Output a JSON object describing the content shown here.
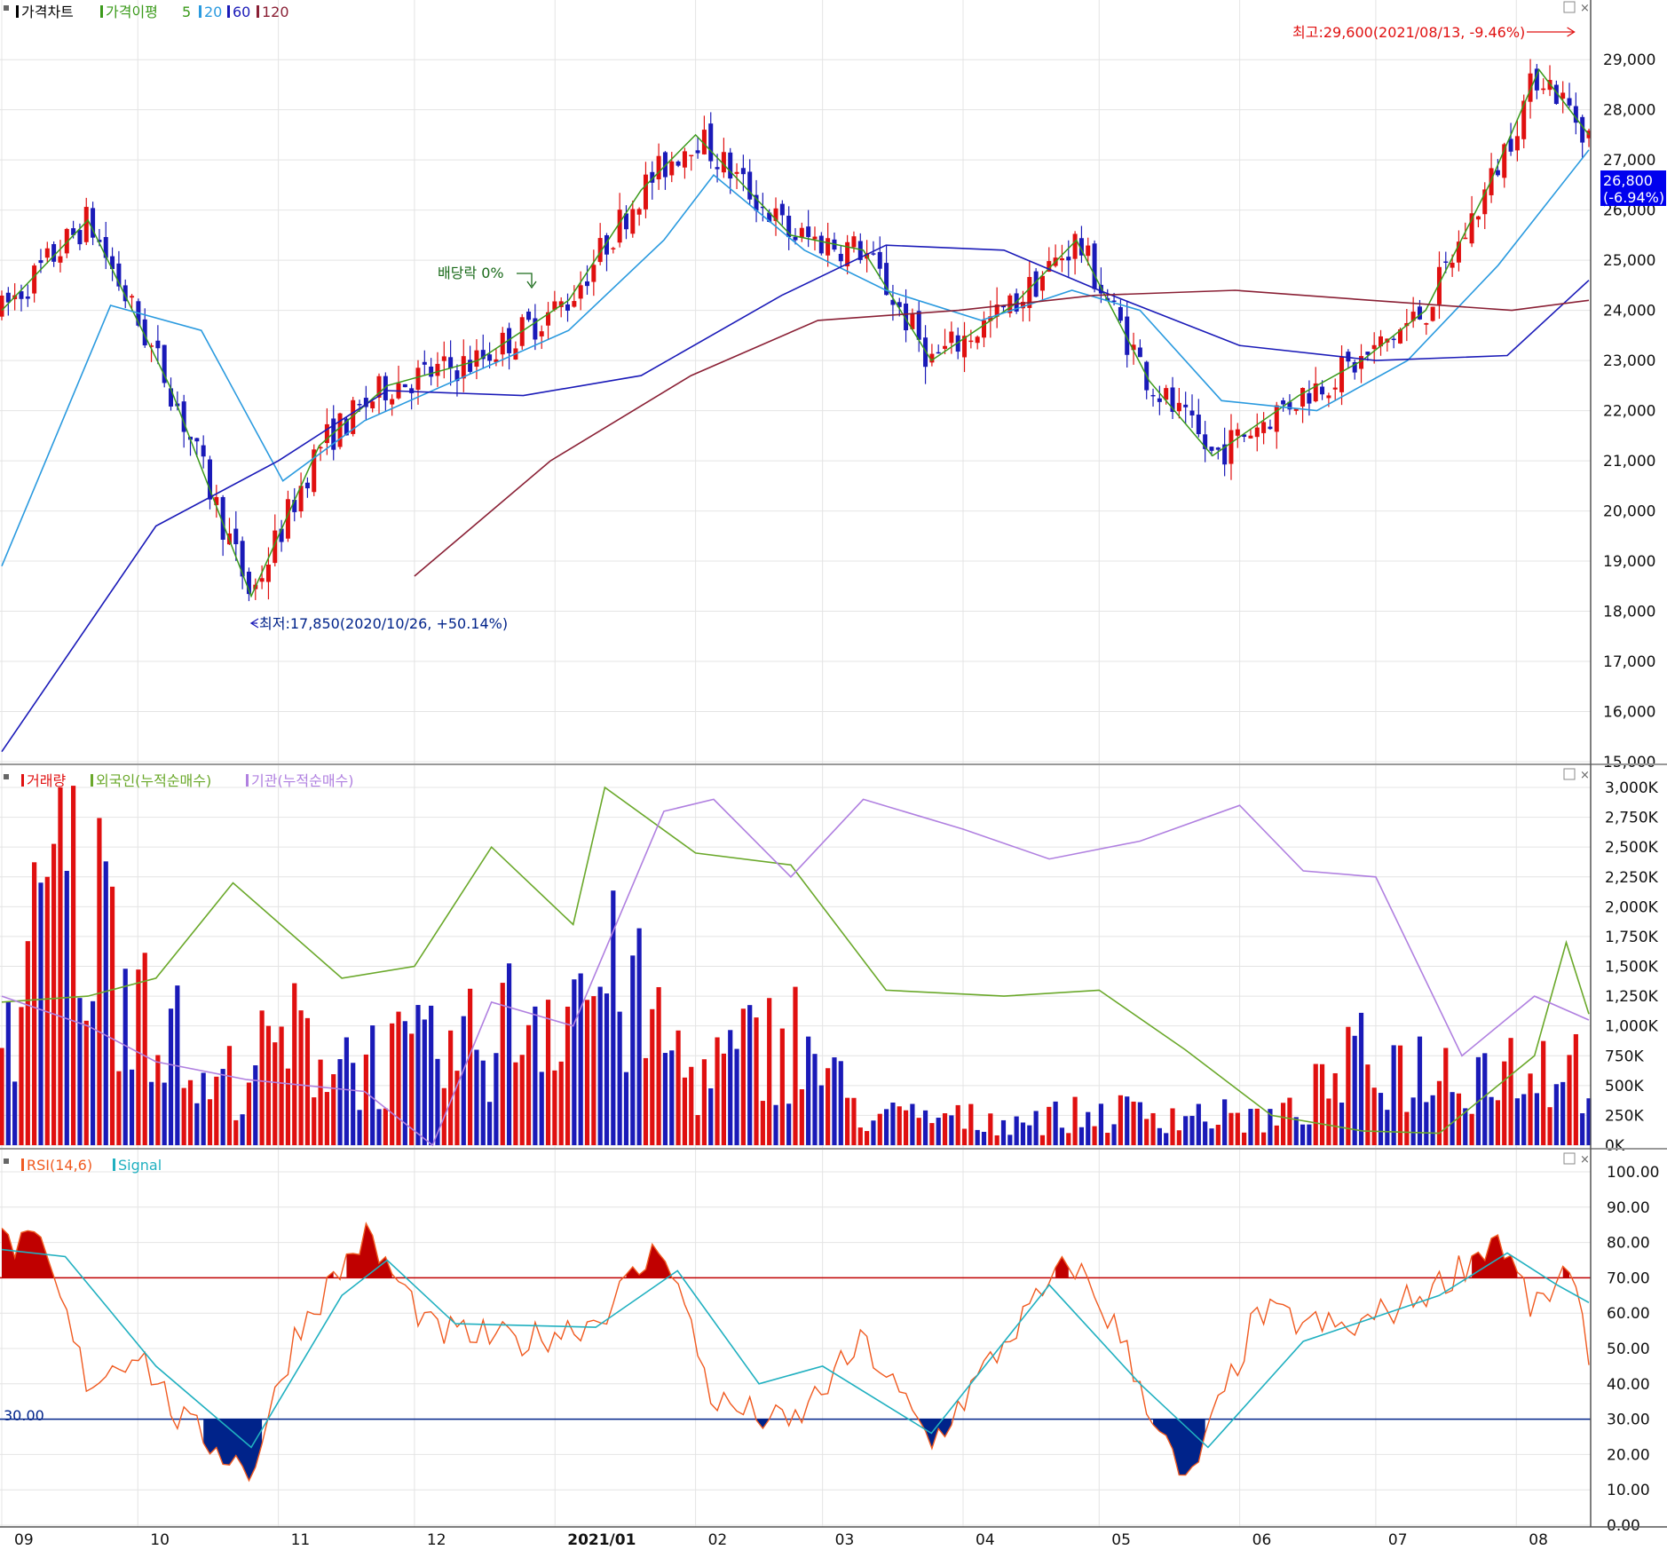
{
  "window_title": "가격차트",
  "colors": {
    "up": "#e01010",
    "down": "#1a1ab8",
    "ma5": "#3a9a1a",
    "ma20": "#2a9adf",
    "ma60": "#1a1ab8",
    "ma120": "#8a2035",
    "grid": "#e4e4e4",
    "foreign": "#6aa82a",
    "institution": "#b080e0",
    "rsi": "#f05a20",
    "signal": "#20b0c0",
    "overbought": "#c00000",
    "oversold": "#00238a",
    "current_price_bg": "#0000ee"
  },
  "icons": [
    "restore-icon",
    "close-icon",
    "series-marker-icon"
  ],
  "price_panel": {
    "legend": {
      "title": "가격차트",
      "ma_label": "가격이평",
      "ma_periods": [
        "5",
        "20",
        "60",
        "120"
      ]
    },
    "y_ticks": [
      "29,000",
      "28,000",
      "27,000",
      "26,000",
      "25,000",
      "24,000",
      "23,000",
      "22,000",
      "21,000",
      "20,000",
      "19,000",
      "18,000",
      "17,000",
      "16,000",
      "15,000"
    ],
    "high_annotation": "최고:29,600(2021/08/13, -9.46%)",
    "low_annotation": "최저:17,850(2020/10/26, +50.14%)",
    "dividend_annotation": "배당락 0%",
    "current_price": "26,800",
    "current_change": "(-6.94%)"
  },
  "volume_panel": {
    "legend": {
      "volume": "거래량",
      "foreign": "외국인(누적순매수)",
      "institution": "기관(누적순매수)"
    },
    "y_ticks": [
      "3,000K",
      "2,750K",
      "2,500K",
      "2,250K",
      "2,000K",
      "1,750K",
      "1,500K",
      "1,250K",
      "1,000K",
      "750K",
      "500K",
      "250K",
      "0K"
    ]
  },
  "rsi_panel": {
    "legend": {
      "rsi": "RSI(14,6)",
      "signal": "Signal"
    },
    "y_ticks": [
      "100.00",
      "90.00",
      "80.00",
      "70.00",
      "60.00",
      "50.00",
      "40.00",
      "30.00",
      "20.00",
      "10.00",
      "0.00"
    ],
    "level_label": "30.00"
  },
  "x_axis": [
    "09",
    "10",
    "11",
    "12",
    "2021/01",
    "02",
    "03",
    "04",
    "05",
    "06",
    "07",
    "08"
  ],
  "chart_data": [
    {
      "type": "candlestick",
      "title": "가격차트",
      "ylim": [
        15000,
        29800
      ],
      "series": [
        {
          "name": "5",
          "x": [
            "2020-09-01",
            "2020-09-20",
            "2020-10-08",
            "2020-10-26",
            "2020-11-10",
            "2020-11-25",
            "2020-12-15",
            "2021-01-04",
            "2021-01-20",
            "2021-02-01",
            "2021-02-22",
            "2021-03-10",
            "2021-03-25",
            "2021-04-12",
            "2021-04-26",
            "2021-05-12",
            "2021-05-26",
            "2021-06-14",
            "2021-06-28",
            "2021-07-12",
            "2021-07-26",
            "2021-08-06",
            "2021-08-17"
          ],
          "values": [
            24000,
            25800,
            22500,
            18300,
            21300,
            22500,
            23000,
            24200,
            26400,
            27500,
            25500,
            25200,
            23000,
            24100,
            25400,
            22600,
            21100,
            22300,
            23000,
            24000,
            26500,
            28800,
            27500
          ]
        },
        {
          "name": "20",
          "x": [
            "2020-09-01",
            "2020-09-25",
            "2020-10-15",
            "2020-11-02",
            "2020-11-20",
            "2020-12-10",
            "2021-01-04",
            "2021-01-25",
            "2021-02-05",
            "2021-02-25",
            "2021-03-15",
            "2021-04-05",
            "2021-04-25",
            "2021-05-10",
            "2021-05-28",
            "2021-06-18",
            "2021-07-08",
            "2021-07-28",
            "2021-08-17"
          ],
          "values": [
            18900,
            24100,
            23600,
            20600,
            21800,
            22600,
            23600,
            25400,
            26700,
            25200,
            24400,
            23800,
            24400,
            24000,
            22200,
            22000,
            23000,
            24900,
            27200
          ]
        },
        {
          "name": "60",
          "x": [
            "2020-09-01",
            "2020-10-05",
            "2020-11-01",
            "2020-11-25",
            "2020-12-25",
            "2021-01-20",
            "2021-02-20",
            "2021-03-15",
            "2021-04-10",
            "2021-05-01",
            "2021-06-01",
            "2021-07-01",
            "2021-07-30",
            "2021-08-17"
          ],
          "values": [
            15200,
            19700,
            21000,
            22400,
            22300,
            22700,
            24300,
            25300,
            25200,
            24400,
            23300,
            23000,
            23100,
            24600
          ]
        },
        {
          "name": "120",
          "x": [
            "2020-12-01",
            "2020-12-31",
            "2021-01-31",
            "2021-02-28",
            "2021-03-31",
            "2021-04-30",
            "2021-05-31",
            "2021-06-30",
            "2021-07-31",
            "2021-08-17"
          ],
          "values": [
            18700,
            21000,
            22700,
            23800,
            24000,
            24300,
            24400,
            24200,
            24000,
            24200
          ]
        }
      ],
      "annotations": [
        {
          "text": "최고:29,600(2021/08/13, -9.46%)",
          "x": "2021-08-13",
          "y": 29600
        },
        {
          "text": "최저:17,850(2020/10/26, +50.14%)",
          "x": "2020-10-26",
          "y": 17850
        },
        {
          "text": "배당락 0%",
          "x": "2020-12-28",
          "y": 24600
        }
      ],
      "last": {
        "x": "2021-08-17",
        "y": 26800,
        "change": "-6.94%"
      }
    },
    {
      "type": "bar",
      "title": "거래량",
      "ylim": [
        0,
        3000
      ],
      "units": "K",
      "series": [
        {
          "name": "외국인(누적순매수)",
          "type": "line",
          "x": [
            "2020-09-01",
            "2020-09-20",
            "2020-10-05",
            "2020-10-22",
            "2020-11-15",
            "2020-12-01",
            "2020-12-18",
            "2021-01-05",
            "2021-01-12",
            "2021-02-01",
            "2021-02-22",
            "2021-03-15",
            "2021-04-10",
            "2021-05-01",
            "2021-05-20",
            "2021-06-08",
            "2021-06-28",
            "2021-07-15",
            "2021-08-05",
            "2021-08-12",
            "2021-08-17"
          ],
          "values": [
            1200,
            1250,
            1400,
            2200,
            1400,
            1500,
            2500,
            1850,
            3000,
            2450,
            2350,
            1300,
            1250,
            1300,
            800,
            250,
            120,
            100,
            750,
            1700,
            1100
          ]
        },
        {
          "name": "기관(누적순매수)",
          "type": "line",
          "x": [
            "2020-09-01",
            "2020-09-20",
            "2020-10-05",
            "2020-10-25",
            "2020-11-20",
            "2020-12-05",
            "2020-12-18",
            "2021-01-05",
            "2021-01-25",
            "2021-02-05",
            "2021-02-22",
            "2021-03-10",
            "2021-04-01",
            "2021-04-20",
            "2021-05-10",
            "2021-06-01",
            "2021-06-15",
            "2021-07-01",
            "2021-07-20",
            "2021-08-05",
            "2021-08-17"
          ],
          "values": [
            1250,
            1000,
            700,
            550,
            450,
            0,
            1200,
            1000,
            2800,
            2900,
            2250,
            2900,
            2650,
            2400,
            2550,
            2850,
            2300,
            2250,
            750,
            1250,
            1050
          ]
        },
        {
          "name": "거래량",
          "type": "bar",
          "x": [
            "2020-09-01",
            "2020-09-14",
            "2020-09-30",
            "2020-10-15",
            "2020-11-05",
            "2020-11-20",
            "2020-12-10",
            "2021-01-04",
            "2021-01-15",
            "2021-02-01",
            "2021-02-22",
            "2021-03-10",
            "2021-04-10",
            "2021-05-10",
            "2021-06-10",
            "2021-06-28",
            "2021-07-15",
            "2021-08-05",
            "2021-08-17"
          ],
          "values": [
            1250,
            3000,
            2350,
            600,
            1250,
            1000,
            1050,
            1900,
            1900,
            800,
            1350,
            350,
            300,
            400,
            300,
            1000,
            900,
            1000,
            950
          ]
        }
      ],
      "yticks": [
        "3,000K",
        "2,750K",
        "2,500K",
        "2,250K",
        "2,000K",
        "1,750K",
        "1,500K",
        "1,250K",
        "1,000K",
        "750K",
        "500K",
        "250K",
        "0K"
      ]
    },
    {
      "type": "line",
      "title": "RSI(14,6)",
      "ylim": [
        0,
        100
      ],
      "series": [
        {
          "name": "RSI(14,6)",
          "x": [
            "2020-09-01",
            "2020-09-10",
            "2020-09-20",
            "2020-10-01",
            "2020-10-10",
            "2020-10-26",
            "2020-11-05",
            "2020-11-20",
            "2020-12-05",
            "2020-12-25",
            "2021-01-10",
            "2021-01-25",
            "2021-02-05",
            "2021-02-22",
            "2021-03-10",
            "2021-03-25",
            "2021-04-12",
            "2021-04-25",
            "2021-05-05",
            "2021-05-20",
            "2021-06-05",
            "2021-06-25",
            "2021-07-15",
            "2021-07-28",
            "2021-08-05",
            "2021-08-12",
            "2021-08-17"
          ],
          "values": [
            80,
            78,
            40,
            50,
            30,
            15,
            55,
            82,
            55,
            52,
            58,
            80,
            35,
            28,
            52,
            23,
            55,
            75,
            55,
            10,
            60,
            55,
            68,
            82,
            60,
            72,
            50
          ]
        },
        {
          "name": "Signal",
          "x": [
            "2020-09-01",
            "2020-09-15",
            "2020-10-05",
            "2020-10-26",
            "2020-11-15",
            "2020-11-25",
            "2020-12-10",
            "2021-01-10",
            "2021-01-28",
            "2021-02-15",
            "2021-03-01",
            "2021-03-25",
            "2021-04-20",
            "2021-05-10",
            "2021-05-25",
            "2021-06-15",
            "2021-07-15",
            "2021-07-30",
            "2021-08-10",
            "2021-08-17"
          ],
          "values": [
            78,
            76,
            45,
            22,
            65,
            75,
            57,
            56,
            72,
            40,
            45,
            26,
            68,
            40,
            22,
            52,
            65,
            77,
            68,
            63
          ]
        }
      ],
      "levels": [
        30,
        70
      ]
    }
  ]
}
